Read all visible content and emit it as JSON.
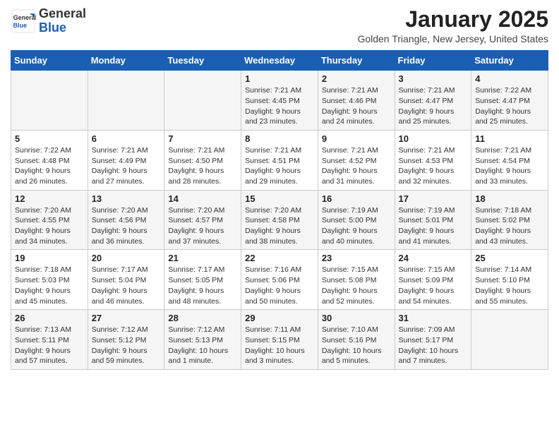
{
  "header": {
    "logo_general": "General",
    "logo_blue": "Blue",
    "month_title": "January 2025",
    "location": "Golden Triangle, New Jersey, United States"
  },
  "weekdays": [
    "Sunday",
    "Monday",
    "Tuesday",
    "Wednesday",
    "Thursday",
    "Friday",
    "Saturday"
  ],
  "weeks": [
    [
      {
        "day": "",
        "info": ""
      },
      {
        "day": "",
        "info": ""
      },
      {
        "day": "",
        "info": ""
      },
      {
        "day": "1",
        "info": "Sunrise: 7:21 AM\nSunset: 4:45 PM\nDaylight: 9 hours\nand 23 minutes."
      },
      {
        "day": "2",
        "info": "Sunrise: 7:21 AM\nSunset: 4:46 PM\nDaylight: 9 hours\nand 24 minutes."
      },
      {
        "day": "3",
        "info": "Sunrise: 7:21 AM\nSunset: 4:47 PM\nDaylight: 9 hours\nand 25 minutes."
      },
      {
        "day": "4",
        "info": "Sunrise: 7:22 AM\nSunset: 4:47 PM\nDaylight: 9 hours\nand 25 minutes."
      }
    ],
    [
      {
        "day": "5",
        "info": "Sunrise: 7:22 AM\nSunset: 4:48 PM\nDaylight: 9 hours\nand 26 minutes."
      },
      {
        "day": "6",
        "info": "Sunrise: 7:21 AM\nSunset: 4:49 PM\nDaylight: 9 hours\nand 27 minutes."
      },
      {
        "day": "7",
        "info": "Sunrise: 7:21 AM\nSunset: 4:50 PM\nDaylight: 9 hours\nand 28 minutes."
      },
      {
        "day": "8",
        "info": "Sunrise: 7:21 AM\nSunset: 4:51 PM\nDaylight: 9 hours\nand 29 minutes."
      },
      {
        "day": "9",
        "info": "Sunrise: 7:21 AM\nSunset: 4:52 PM\nDaylight: 9 hours\nand 31 minutes."
      },
      {
        "day": "10",
        "info": "Sunrise: 7:21 AM\nSunset: 4:53 PM\nDaylight: 9 hours\nand 32 minutes."
      },
      {
        "day": "11",
        "info": "Sunrise: 7:21 AM\nSunset: 4:54 PM\nDaylight: 9 hours\nand 33 minutes."
      }
    ],
    [
      {
        "day": "12",
        "info": "Sunrise: 7:20 AM\nSunset: 4:55 PM\nDaylight: 9 hours\nand 34 minutes."
      },
      {
        "day": "13",
        "info": "Sunrise: 7:20 AM\nSunset: 4:56 PM\nDaylight: 9 hours\nand 36 minutes."
      },
      {
        "day": "14",
        "info": "Sunrise: 7:20 AM\nSunset: 4:57 PM\nDaylight: 9 hours\nand 37 minutes."
      },
      {
        "day": "15",
        "info": "Sunrise: 7:20 AM\nSunset: 4:58 PM\nDaylight: 9 hours\nand 38 minutes."
      },
      {
        "day": "16",
        "info": "Sunrise: 7:19 AM\nSunset: 5:00 PM\nDaylight: 9 hours\nand 40 minutes."
      },
      {
        "day": "17",
        "info": "Sunrise: 7:19 AM\nSunset: 5:01 PM\nDaylight: 9 hours\nand 41 minutes."
      },
      {
        "day": "18",
        "info": "Sunrise: 7:18 AM\nSunset: 5:02 PM\nDaylight: 9 hours\nand 43 minutes."
      }
    ],
    [
      {
        "day": "19",
        "info": "Sunrise: 7:18 AM\nSunset: 5:03 PM\nDaylight: 9 hours\nand 45 minutes."
      },
      {
        "day": "20",
        "info": "Sunrise: 7:17 AM\nSunset: 5:04 PM\nDaylight: 9 hours\nand 46 minutes."
      },
      {
        "day": "21",
        "info": "Sunrise: 7:17 AM\nSunset: 5:05 PM\nDaylight: 9 hours\nand 48 minutes."
      },
      {
        "day": "22",
        "info": "Sunrise: 7:16 AM\nSunset: 5:06 PM\nDaylight: 9 hours\nand 50 minutes."
      },
      {
        "day": "23",
        "info": "Sunrise: 7:15 AM\nSunset: 5:08 PM\nDaylight: 9 hours\nand 52 minutes."
      },
      {
        "day": "24",
        "info": "Sunrise: 7:15 AM\nSunset: 5:09 PM\nDaylight: 9 hours\nand 54 minutes."
      },
      {
        "day": "25",
        "info": "Sunrise: 7:14 AM\nSunset: 5:10 PM\nDaylight: 9 hours\nand 55 minutes."
      }
    ],
    [
      {
        "day": "26",
        "info": "Sunrise: 7:13 AM\nSunset: 5:11 PM\nDaylight: 9 hours\nand 57 minutes."
      },
      {
        "day": "27",
        "info": "Sunrise: 7:12 AM\nSunset: 5:12 PM\nDaylight: 9 hours\nand 59 minutes."
      },
      {
        "day": "28",
        "info": "Sunrise: 7:12 AM\nSunset: 5:13 PM\nDaylight: 10 hours\nand 1 minute."
      },
      {
        "day": "29",
        "info": "Sunrise: 7:11 AM\nSunset: 5:15 PM\nDaylight: 10 hours\nand 3 minutes."
      },
      {
        "day": "30",
        "info": "Sunrise: 7:10 AM\nSunset: 5:16 PM\nDaylight: 10 hours\nand 5 minutes."
      },
      {
        "day": "31",
        "info": "Sunrise: 7:09 AM\nSunset: 5:17 PM\nDaylight: 10 hours\nand 7 minutes."
      },
      {
        "day": "",
        "info": ""
      }
    ]
  ]
}
